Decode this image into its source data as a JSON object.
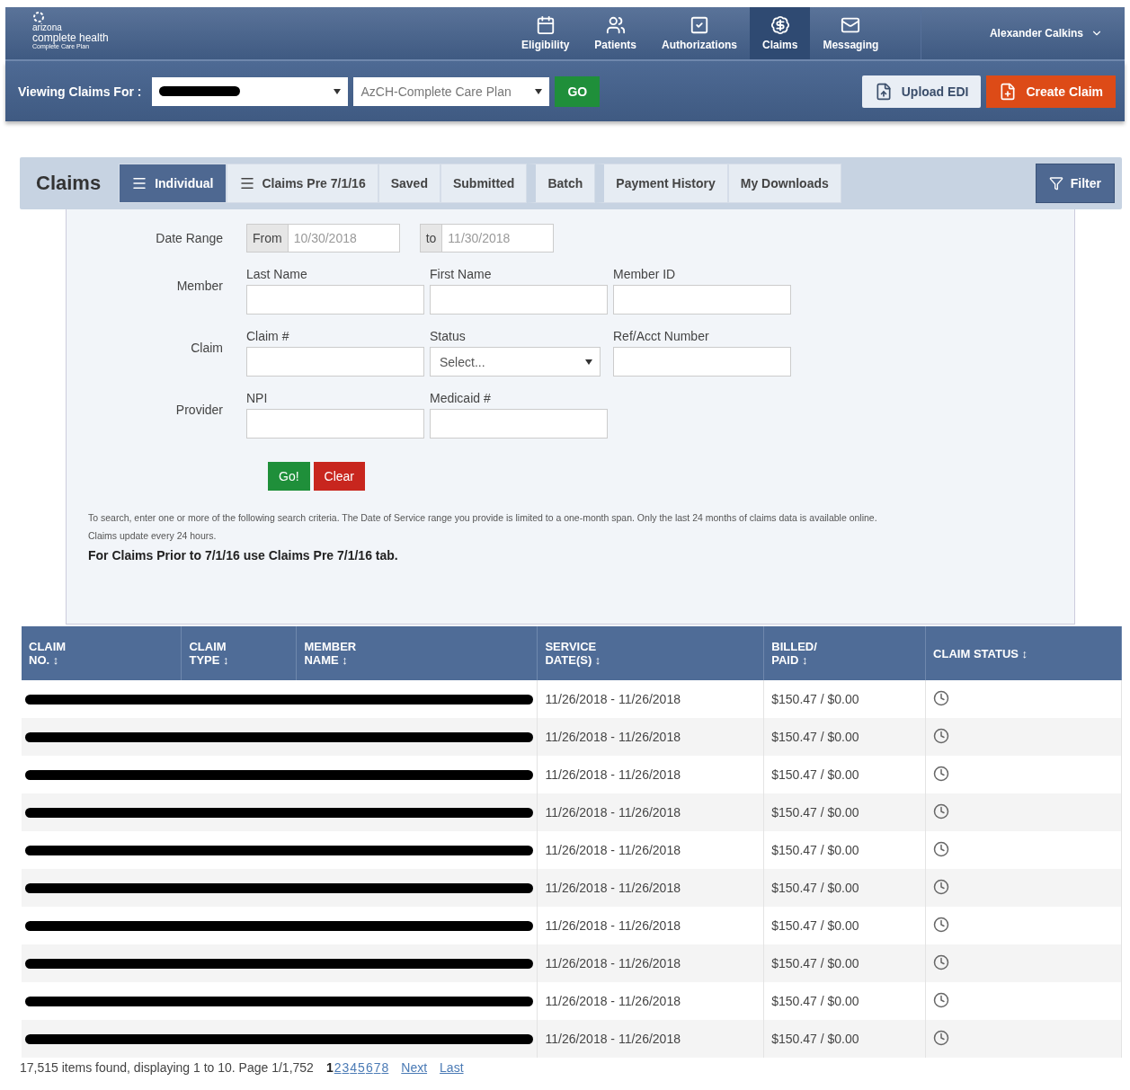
{
  "header": {
    "logo": {
      "line1": "arizona",
      "line2": "complete health",
      "line3": "Complete Care Plan"
    },
    "nav": [
      {
        "label": "Eligibility",
        "selected": false
      },
      {
        "label": "Patients",
        "selected": false
      },
      {
        "label": "Authorizations",
        "selected": false
      },
      {
        "label": "Claims",
        "selected": true
      },
      {
        "label": "Messaging",
        "selected": false
      }
    ],
    "user": "Alexander Calkins"
  },
  "toolbar": {
    "label": "Viewing Claims For :",
    "plan": "AzCH-Complete Care Plan",
    "go": "GO",
    "upload": "Upload EDI",
    "create": "Create Claim"
  },
  "claims_tabs": {
    "title": "Claims",
    "filter": "Filter",
    "tabs": [
      {
        "label": "Individual",
        "menu_icon": true,
        "gap_before": false,
        "selected": true
      },
      {
        "label": "Claims Pre 7/1/16",
        "menu_icon": true,
        "gap_before": false,
        "selected": false
      },
      {
        "label": "Saved",
        "menu_icon": false,
        "gap_before": false,
        "selected": false
      },
      {
        "label": "Submitted",
        "menu_icon": false,
        "gap_before": false,
        "selected": false
      },
      {
        "label": "Batch",
        "menu_icon": false,
        "gap_before": true,
        "selected": false
      },
      {
        "label": "Payment History",
        "menu_icon": false,
        "gap_before": true,
        "selected": false
      },
      {
        "label": "My Downloads",
        "menu_icon": false,
        "gap_before": false,
        "selected": false
      }
    ]
  },
  "form": {
    "date_range": {
      "label": "Date Range",
      "from_label": "From",
      "from": "10/30/2018",
      "to_label": "to",
      "to": "11/30/2018"
    },
    "groups": [
      {
        "label": "Member",
        "fields": [
          {
            "kind": "text",
            "label": "Last Name"
          },
          {
            "kind": "text",
            "label": "First Name"
          },
          {
            "kind": "text",
            "label": "Member ID"
          }
        ]
      },
      {
        "label": "Claim",
        "fields": [
          {
            "kind": "text",
            "label": "Claim #"
          },
          {
            "kind": "select",
            "label": "Status",
            "value": "Select..."
          },
          {
            "kind": "text",
            "label": "Ref/Acct Number"
          }
        ]
      },
      {
        "label": "Provider",
        "fields": [
          {
            "kind": "text",
            "label": "NPI"
          },
          {
            "kind": "text",
            "label": "Medicaid #"
          }
        ]
      }
    ],
    "go": "Go!",
    "clear": "Clear",
    "note": "To search, enter one or more of the following search criteria. The Date of Service range you provide is limited to a one-month span. Only the last 24 months of claims data is available online.",
    "note2": "Claims update every 24 hours.",
    "note_bold": "For Claims Prior to 7/1/16 use Claims Pre 7/1/16 tab."
  },
  "table": {
    "columns": [
      {
        "line1": "CLAIM",
        "line2": "NO. ↕"
      },
      {
        "line1": "CLAIM",
        "line2": "TYPE ↕"
      },
      {
        "line1": "MEMBER",
        "line2": "NAME ↕"
      },
      {
        "line1": "SERVICE",
        "line2": "DATE(S) ↕"
      },
      {
        "line1": "BILLED/",
        "line2": "PAID ↕"
      },
      {
        "line1": "CLAIM STATUS ↕"
      }
    ],
    "rows": [
      {
        "service": "11/26/2018 - 11/26/2018",
        "billed_paid": "$150.47  / $0.00"
      },
      {
        "service": "11/26/2018 - 11/26/2018",
        "billed_paid": "$150.47  / $0.00"
      },
      {
        "service": "11/26/2018 - 11/26/2018",
        "billed_paid": "$150.47  / $0.00"
      },
      {
        "service": "11/26/2018 - 11/26/2018",
        "billed_paid": "$150.47  / $0.00"
      },
      {
        "service": "11/26/2018 - 11/26/2018",
        "billed_paid": "$150.47  / $0.00"
      },
      {
        "service": "11/26/2018 - 11/26/2018",
        "billed_paid": "$150.47  / $0.00"
      },
      {
        "service": "11/26/2018 - 11/26/2018",
        "billed_paid": "$150.47  / $0.00"
      },
      {
        "service": "11/26/2018 - 11/26/2018",
        "billed_paid": "$150.47  / $0.00"
      },
      {
        "service": "11/26/2018 - 11/26/2018",
        "billed_paid": "$150.47  / $0.00"
      },
      {
        "service": "11/26/2018 - 11/26/2018",
        "billed_paid": "$150.47  / $0.00"
      }
    ]
  },
  "footer": {
    "summary": "17,515 items found, displaying 1 to 10. Page 1/1,752",
    "pages": [
      {
        "label": "1",
        "selected": true
      },
      {
        "label": "2",
        "selected": false
      },
      {
        "label": "3",
        "selected": false
      },
      {
        "label": "4",
        "selected": false
      },
      {
        "label": "5",
        "selected": false
      },
      {
        "label": "6",
        "selected": false
      },
      {
        "label": "7",
        "selected": false
      },
      {
        "label": "8",
        "selected": false
      }
    ],
    "next": "Next",
    "last": "Last"
  }
}
